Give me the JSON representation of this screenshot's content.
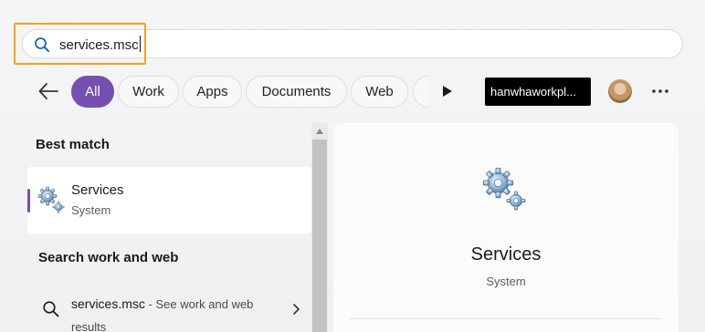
{
  "search": {
    "query": "services.msc",
    "icon": "search-icon"
  },
  "filters": {
    "back_icon": "back-arrow-icon",
    "chips": [
      "All",
      "Work",
      "Apps",
      "Documents",
      "Web"
    ],
    "active": "All",
    "more_icon": "play-icon"
  },
  "account": {
    "name": "hanwhaworkpl..."
  },
  "toolbar": {
    "more_icon": "more-options-icon"
  },
  "results": {
    "best_match_heading": "Best match",
    "best_match": {
      "title": "Services",
      "subtitle": "System",
      "icon": "services-gear-icon"
    },
    "web_heading": "Search work and web",
    "web_item": {
      "query": "services.msc",
      "suffix": " - See work and web results",
      "icon": "search-icon"
    }
  },
  "details": {
    "title": "Services",
    "subtitle": "System",
    "icon": "services-gear-icon"
  },
  "colors": {
    "accent": "#7550b0",
    "highlight": "#f7a21b"
  }
}
